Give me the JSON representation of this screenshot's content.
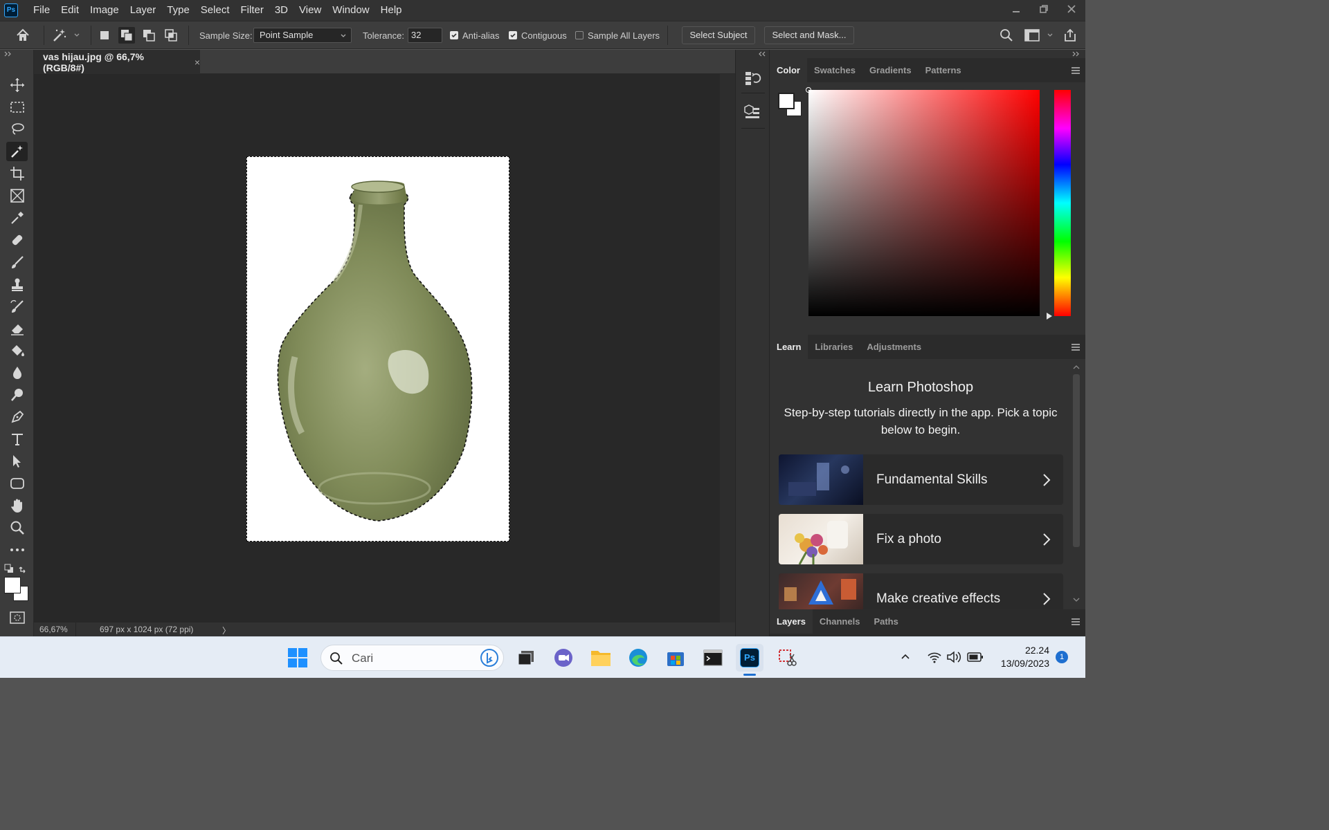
{
  "app": {
    "logo_text": "Ps"
  },
  "menu": [
    "File",
    "Edit",
    "Image",
    "Layer",
    "Type",
    "Select",
    "Filter",
    "3D",
    "View",
    "Window",
    "Help"
  ],
  "options": {
    "sample_size_label": "Sample Size:",
    "sample_size_value": "Point Sample",
    "tolerance_label": "Tolerance:",
    "tolerance_value": "32",
    "anti_alias_label": "Anti-alias",
    "anti_alias_checked": true,
    "contiguous_label": "Contiguous",
    "contiguous_checked": true,
    "sample_all_layers_label": "Sample All Layers",
    "sample_all_layers_checked": false,
    "select_subject_label": "Select Subject",
    "select_mask_label": "Select and Mask..."
  },
  "document": {
    "tab_title": "vas hijau.jpg @ 66,7% (RGB/8#)",
    "close_symbol": "×",
    "zoom": "66,67%",
    "size_info": "697 px x 1024 px (72 ppi)",
    "status_arrow": "〉"
  },
  "tools": [
    "move-tool",
    "marquee-tool",
    "lasso-tool",
    "magic-wand-tool",
    "crop-tool",
    "frame-tool",
    "eyedropper-tool",
    "healing-tool",
    "brush-tool",
    "stamp-tool",
    "history-brush-tool",
    "eraser-tool",
    "paint-bucket-tool",
    "blur-tool",
    "dodge-tool",
    "pen-tool",
    "type-tool",
    "path-selection-tool",
    "shape-tool",
    "hand-tool",
    "zoom-tool",
    "more-tools"
  ],
  "active_tool": "magic-wand-tool",
  "color_panel": {
    "tabs": [
      "Color",
      "Swatches",
      "Gradients",
      "Patterns"
    ],
    "active_tab": "Color",
    "hue_color": "#ff0000"
  },
  "learn_panel": {
    "tabs": [
      "Learn",
      "Libraries",
      "Adjustments"
    ],
    "active_tab": "Learn",
    "title": "Learn Photoshop",
    "description": "Step-by-step tutorials directly in the app. Pick a topic below to begin.",
    "cards": [
      {
        "label": "Fundamental Skills"
      },
      {
        "label": "Fix a photo"
      },
      {
        "label": "Make creative effects"
      }
    ]
  },
  "layers_panel": {
    "tabs": [
      "Layers",
      "Channels",
      "Paths"
    ],
    "active_tab": "Layers"
  },
  "taskbar": {
    "search_placeholder": "Cari",
    "time": "22.24",
    "date": "13/09/2023",
    "notification_count": "1"
  }
}
